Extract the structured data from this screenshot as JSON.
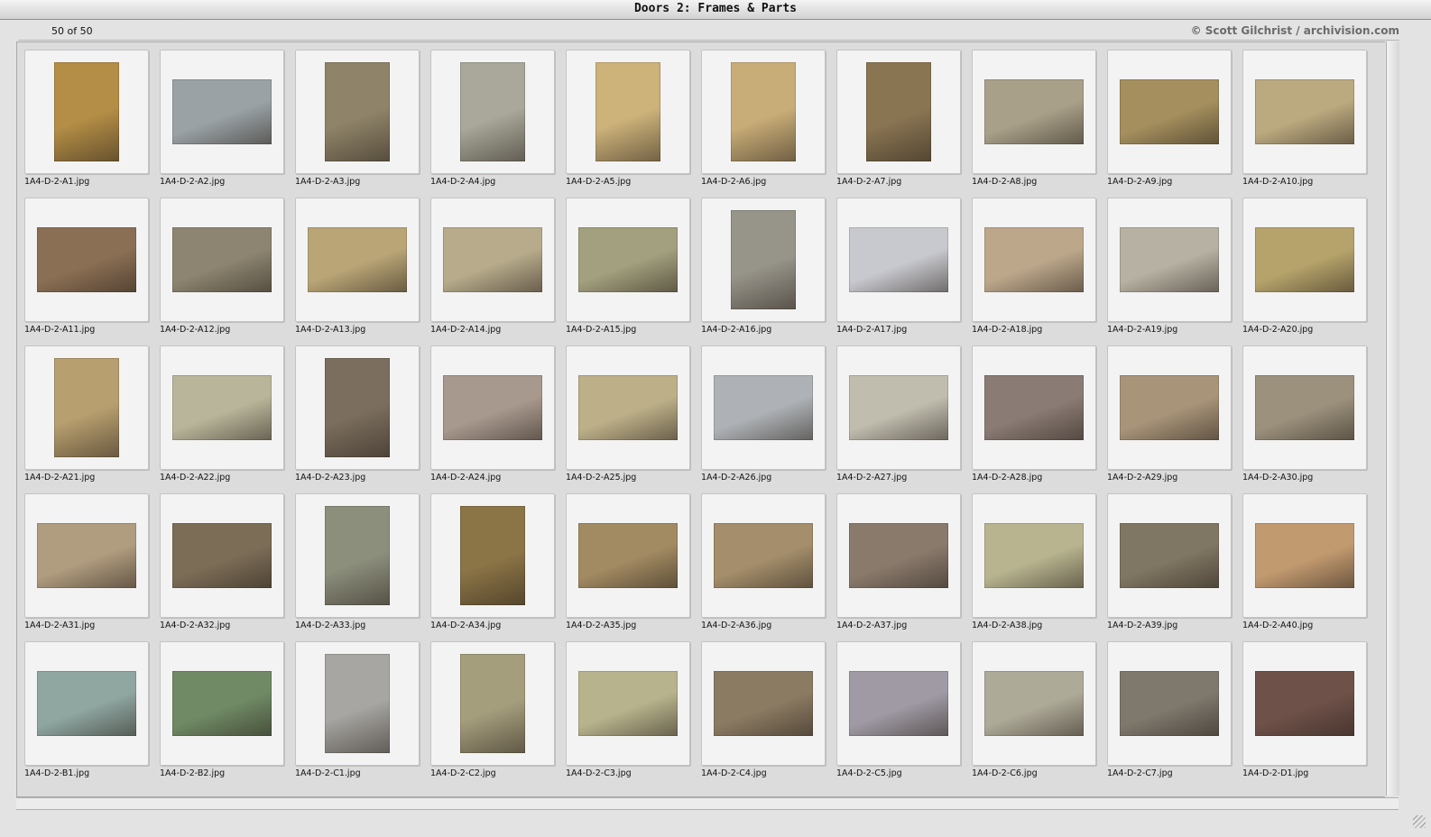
{
  "window": {
    "title": "Doors 2: Frames & Parts"
  },
  "header": {
    "count": "50 of 50",
    "credit": "© Scott Gilchrist / archivision.com"
  },
  "items": [
    {
      "file": "1A4-D-2-A1.jpg",
      "o": "p",
      "c": "#b48e46"
    },
    {
      "file": "1A4-D-2-A2.jpg",
      "o": "l",
      "c": "#9aa2a6"
    },
    {
      "file": "1A4-D-2-A3.jpg",
      "o": "p",
      "c": "#8f8469"
    },
    {
      "file": "1A4-D-2-A4.jpg",
      "o": "p",
      "c": "#a9a89a"
    },
    {
      "file": "1A4-D-2-A5.jpg",
      "o": "p",
      "c": "#cdb27a"
    },
    {
      "file": "1A4-D-2-A6.jpg",
      "o": "p",
      "c": "#c9ad78"
    },
    {
      "file": "1A4-D-2-A7.jpg",
      "o": "p",
      "c": "#8a7553"
    },
    {
      "file": "1A4-D-2-A8.jpg",
      "o": "l",
      "c": "#a8a088"
    },
    {
      "file": "1A4-D-2-A9.jpg",
      "o": "l",
      "c": "#a58f5e"
    },
    {
      "file": "1A4-D-2-A10.jpg",
      "o": "l",
      "c": "#bba97f"
    },
    {
      "file": "1A4-D-2-A11.jpg",
      "o": "l",
      "c": "#8b6f54"
    },
    {
      "file": "1A4-D-2-A12.jpg",
      "o": "l",
      "c": "#8d8571"
    },
    {
      "file": "1A4-D-2-A13.jpg",
      "o": "l",
      "c": "#b9a576"
    },
    {
      "file": "1A4-D-2-A14.jpg",
      "o": "l",
      "c": "#b7ab8b"
    },
    {
      "file": "1A4-D-2-A15.jpg",
      "o": "l",
      "c": "#a2a07e"
    },
    {
      "file": "1A4-D-2-A16.jpg",
      "o": "p",
      "c": "#97948a"
    },
    {
      "file": "1A4-D-2-A17.jpg",
      "o": "l",
      "c": "#c8c9cf"
    },
    {
      "file": "1A4-D-2-A18.jpg",
      "o": "l",
      "c": "#bca78b"
    },
    {
      "file": "1A4-D-2-A19.jpg",
      "o": "l",
      "c": "#b7b1a3"
    },
    {
      "file": "1A4-D-2-A20.jpg",
      "o": "l",
      "c": "#b6a36b"
    },
    {
      "file": "1A4-D-2-A21.jpg",
      "o": "p",
      "c": "#b89f6f"
    },
    {
      "file": "1A4-D-2-A22.jpg",
      "o": "l",
      "c": "#b9b59a"
    },
    {
      "file": "1A4-D-2-A23.jpg",
      "o": "p",
      "c": "#7b6e5e"
    },
    {
      "file": "1A4-D-2-A24.jpg",
      "o": "l",
      "c": "#a8998e"
    },
    {
      "file": "1A4-D-2-A25.jpg",
      "o": "l",
      "c": "#bdb089"
    },
    {
      "file": "1A4-D-2-A26.jpg",
      "o": "l",
      "c": "#aeb2b6"
    },
    {
      "file": "1A4-D-2-A27.jpg",
      "o": "l",
      "c": "#c0bcae"
    },
    {
      "file": "1A4-D-2-A28.jpg",
      "o": "l",
      "c": "#8a7b74"
    },
    {
      "file": "1A4-D-2-A29.jpg",
      "o": "l",
      "c": "#a89479"
    },
    {
      "file": "1A4-D-2-A30.jpg",
      "o": "l",
      "c": "#9c917d"
    },
    {
      "file": "1A4-D-2-A31.jpg",
      "o": "l",
      "c": "#b09c7f"
    },
    {
      "file": "1A4-D-2-A32.jpg",
      "o": "l",
      "c": "#7c6d57"
    },
    {
      "file": "1A4-D-2-A33.jpg",
      "o": "p",
      "c": "#8d8f7d"
    },
    {
      "file": "1A4-D-2-A34.jpg",
      "o": "p",
      "c": "#8b7446"
    },
    {
      "file": "1A4-D-2-A35.jpg",
      "o": "l",
      "c": "#a28a62"
    },
    {
      "file": "1A4-D-2-A36.jpg",
      "o": "l",
      "c": "#a48e6b"
    },
    {
      "file": "1A4-D-2-A37.jpg",
      "o": "l",
      "c": "#8a7a6c"
    },
    {
      "file": "1A4-D-2-A38.jpg",
      "o": "l",
      "c": "#b7b48f"
    },
    {
      "file": "1A4-D-2-A39.jpg",
      "o": "l",
      "c": "#7f7663"
    },
    {
      "file": "1A4-D-2-A40.jpg",
      "o": "l",
      "c": "#c29a70"
    },
    {
      "file": "1A4-D-2-B1.jpg",
      "o": "l",
      "c": "#8fa6a1"
    },
    {
      "file": "1A4-D-2-B2.jpg",
      "o": "l",
      "c": "#6f8a65"
    },
    {
      "file": "1A4-D-2-C1.jpg",
      "o": "p",
      "c": "#a7a6a2"
    },
    {
      "file": "1A4-D-2-C2.jpg",
      "o": "p",
      "c": "#a59e7d"
    },
    {
      "file": "1A4-D-2-C3.jpg",
      "o": "l",
      "c": "#b7b48d"
    },
    {
      "file": "1A4-D-2-C4.jpg",
      "o": "l",
      "c": "#8c7b63"
    },
    {
      "file": "1A4-D-2-C5.jpg",
      "o": "l",
      "c": "#9f9aa4"
    },
    {
      "file": "1A4-D-2-C6.jpg",
      "o": "l",
      "c": "#aeaa98"
    },
    {
      "file": "1A4-D-2-C7.jpg",
      "o": "l",
      "c": "#7e786d"
    },
    {
      "file": "1A4-D-2-D1.jpg",
      "o": "l",
      "c": "#6e5149"
    }
  ]
}
